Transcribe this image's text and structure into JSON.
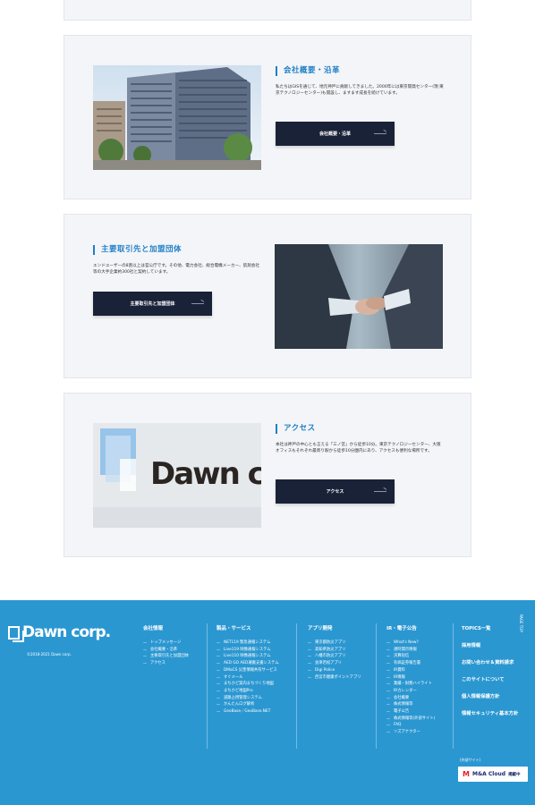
{
  "sections": [
    {
      "heading": "会社概要・沿革",
      "description": "私たちはGISを通じて、地元神戸に貢献してきました。2000年には東京開発センター(現:東京テクノロジーセンター)も開設し、ますます成長を続けています。",
      "button_label": "会社概要・沿革"
    },
    {
      "heading": "主要取引先と加盟団体",
      "description": "エンドユーザーの8割以上は官公庁です。その他、電力会社、総合電機メーカー、航測会社等の大手企業約300社と契約しています。",
      "button_label": "主要取引先と加盟団体"
    },
    {
      "heading": "アクセス",
      "description": "本社は神戸の中心とも言える「三ノ宮」から徒歩10分。東京テクノロジーセンター、大阪オフィスもそれぞれ最寄り駅から徒歩10分圏内にあり、アクセスも便利な場所です。",
      "button_label": "アクセス",
      "photo_sign_text": "Dawn corp."
    }
  ],
  "footer": {
    "logo_text": "Dawn corp.",
    "copyright": "©2018-2021 Dawn corp.",
    "page_top": "PAGE TOP",
    "columns": [
      {
        "title": "会社情報",
        "items": [
          "トップメッセージ",
          "会社概要・沿革",
          "主要取引先と加盟団体",
          "アクセス"
        ]
      },
      {
        "title": "製品・サービス",
        "items": [
          "NET119 緊急通報システム",
          "Live119 映像通報システム",
          "Live110 映像通報システム",
          "AED GO AED運搬支援システム",
          "DMaCS 災害情報共有サービス",
          "すぐメール",
          "まちかど案内まちづくり地図",
          "まちかど地図Pro",
          "道路占用管理システム",
          "かんたんログ解析",
          "GeoBase／GeoBase.NET"
        ]
      },
      {
        "title": "アプリ開発",
        "items": [
          "東京都防災アプリ",
          "高知県防災アプリ",
          "八幡市防災アプリ",
          "会津若松アプリ",
          "Digi Police",
          "西宮市健康ポイントアプリ"
        ]
      },
      {
        "title": "IR・電子公告",
        "items": [
          "What's New?",
          "適時開示情報",
          "決算短信",
          "有価証券報告書",
          "IR資料",
          "IR情報",
          "業績・財務ハイライト",
          "IRカレンダー",
          "会社概要",
          "株式情報等",
          "電子公告",
          "株式情報等(外部サイト)",
          "FAQ",
          "ソズアナクター"
        ]
      }
    ],
    "top_links": [
      "TOPICS一覧",
      "採用情報",
      "お問い合わせ＆資料請求",
      "このサイトについて",
      "個人情報保護方針",
      "情報セキュリティ基本方針"
    ],
    "external_label": "(外部サイト)",
    "badge": {
      "name": "M&A Cloud",
      "tag": "掲載中"
    }
  },
  "colors": {
    "accent": "#1f7fc6",
    "button": "#1a2238",
    "footer": "#2b97d1",
    "card_bg": "#f4f5f8"
  }
}
